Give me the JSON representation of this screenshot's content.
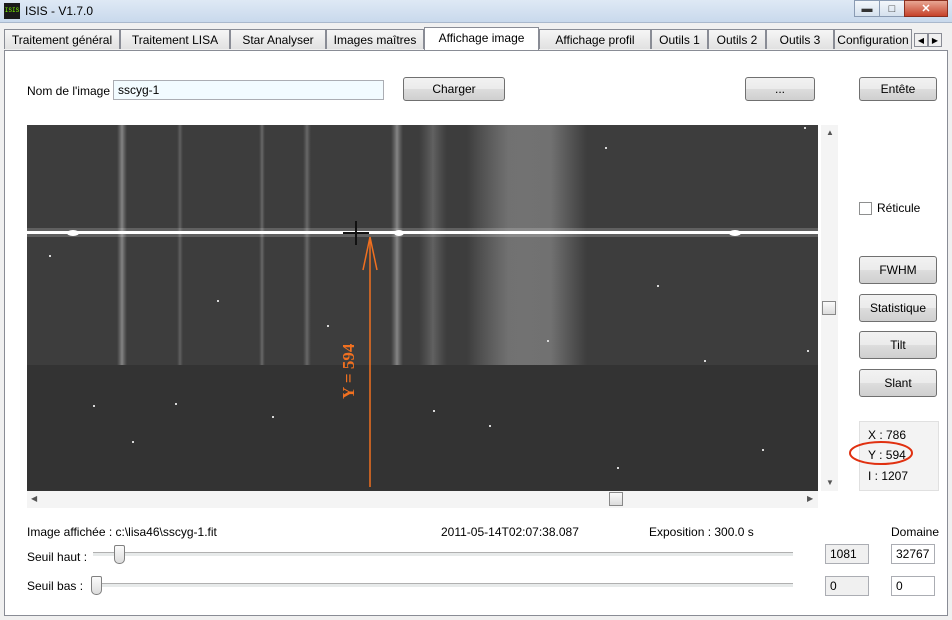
{
  "window": {
    "title": "ISIS - V1.7.0",
    "icon": "ISIS"
  },
  "tabs": [
    {
      "label": "Traitement général",
      "active": false
    },
    {
      "label": "Traitement LISA",
      "active": false
    },
    {
      "label": "Star Analyser",
      "active": false
    },
    {
      "label": "Images maîtres",
      "active": false
    },
    {
      "label": "Affichage image",
      "active": true
    },
    {
      "label": "Affichage profil",
      "active": false
    },
    {
      "label": "Outils 1",
      "active": false
    },
    {
      "label": "Outils 2",
      "active": false
    },
    {
      "label": "Outils 3",
      "active": false
    },
    {
      "label": "Configuration",
      "active": false
    }
  ],
  "image_name": {
    "label": "Nom de l'image :",
    "value": "sscyg-1"
  },
  "buttons": {
    "load": "Charger",
    "browse": "...",
    "header": "Entête",
    "fwhm": "FWHM",
    "stats": "Statistique",
    "tilt": "Tilt",
    "slant": "Slant"
  },
  "reticle": {
    "label": "Réticule",
    "checked": false
  },
  "annotation": {
    "text": "Y = 594",
    "color": "#f07020"
  },
  "coords": {
    "x": "X : 786",
    "y": "Y : 594",
    "i": "I : 1207"
  },
  "info": {
    "displayed": "Image affichée : c:\\lisa46\\sscyg-1.fit",
    "date": "2011-05-14T02:07:38.087",
    "exposure": "Exposition : 300.0 s",
    "domain_label": "Domaine"
  },
  "threshold_high": {
    "label": "Seuil haut :",
    "value": "1081",
    "domain": "32767",
    "level": 0.033
  },
  "threshold_low": {
    "label": "Seuil bas :",
    "value": "0",
    "domain": "0",
    "level": 0
  },
  "scroll": {
    "vertical": 0.5,
    "horizontal": 0.76
  }
}
